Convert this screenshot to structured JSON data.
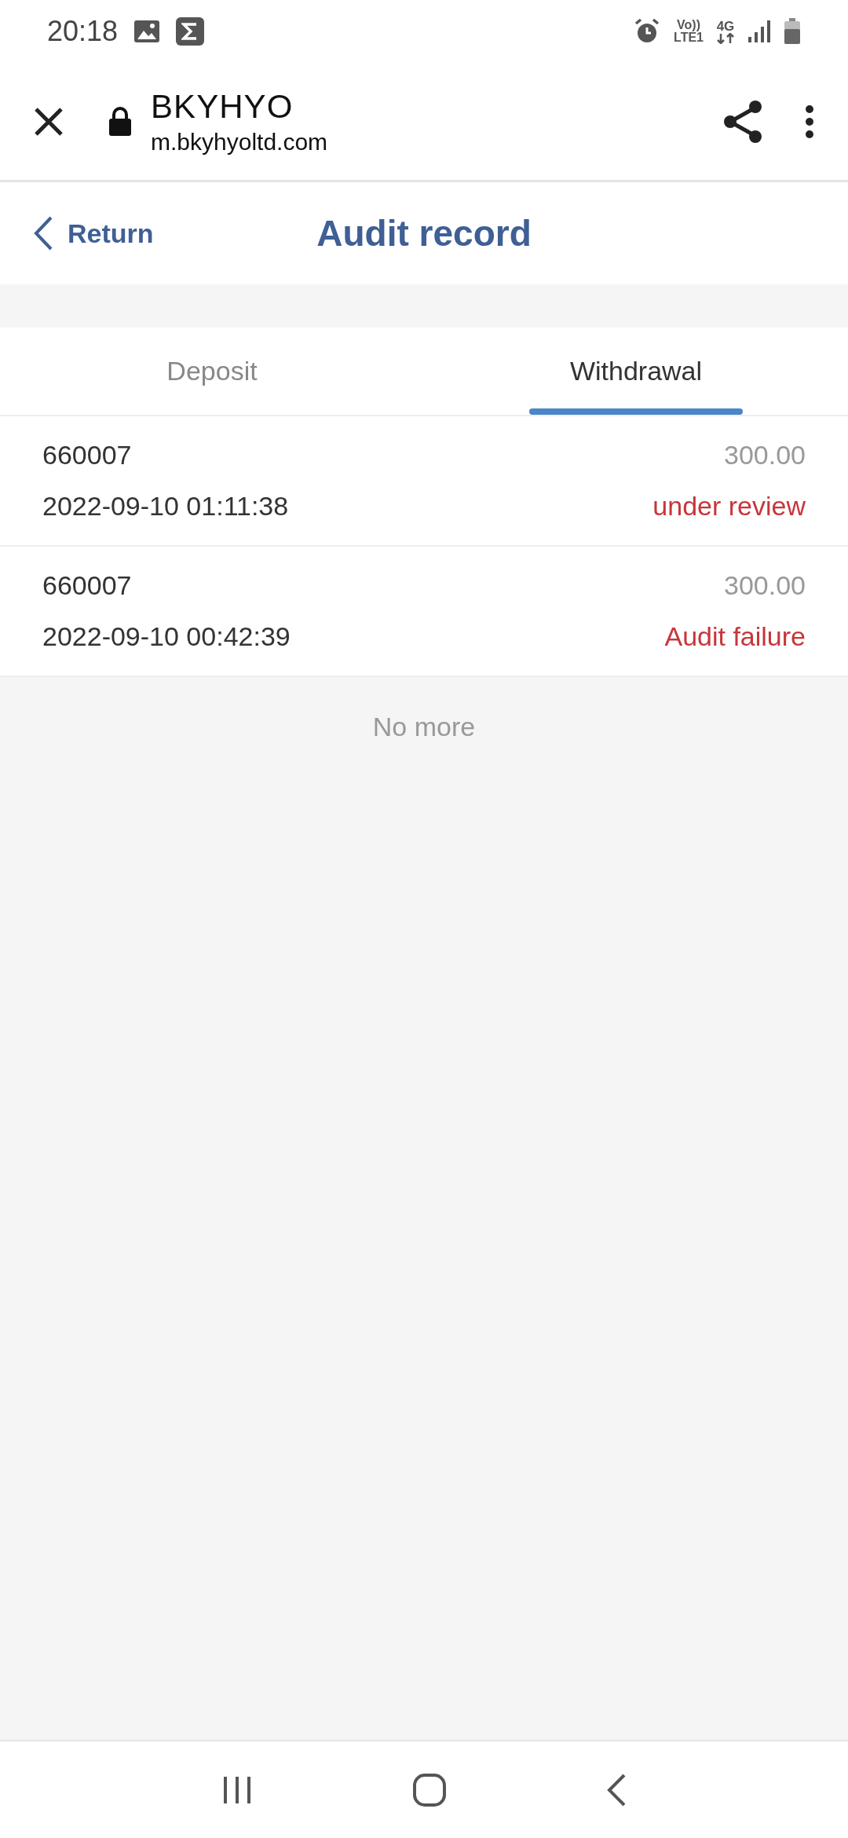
{
  "status_bar": {
    "time": "20:18",
    "volte": "Vo))",
    "lte": "LTE1",
    "network": "4G"
  },
  "browser_bar": {
    "site_title": "BKYHYO",
    "url": "m.bkyhyoltd.com"
  },
  "header": {
    "back_label": "Return",
    "title": "Audit record"
  },
  "tabs": [
    {
      "label": "Deposit",
      "selected": false
    },
    {
      "label": "Withdrawal",
      "selected": true
    }
  ],
  "records": [
    {
      "id": "660007",
      "time": "2022-09-10 01:11:38",
      "amount": "300.00",
      "status": "under review"
    },
    {
      "id": "660007",
      "time": "2022-09-10 00:42:39",
      "amount": "300.00",
      "status": "Audit failure"
    }
  ],
  "end_note": "No more"
}
